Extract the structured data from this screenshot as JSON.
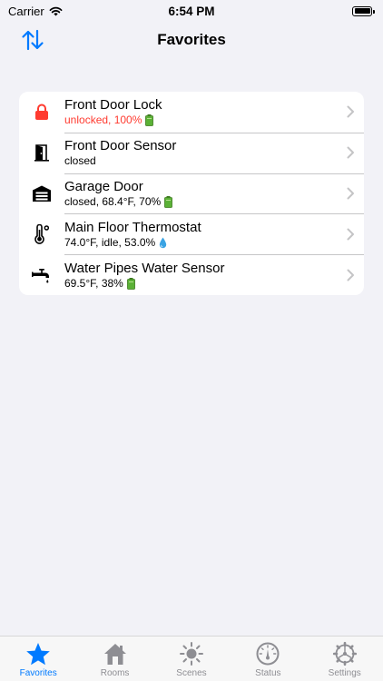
{
  "status_bar": {
    "carrier": "Carrier",
    "time": "6:54 PM"
  },
  "nav": {
    "title": "Favorites",
    "sort_icon": "up-down-arrows-icon"
  },
  "colors": {
    "accent": "#007aff",
    "alert": "#ff3b30",
    "battery_green": "#5bb136",
    "inactive": "#8e8e93"
  },
  "favorites": [
    {
      "title": "Front Door Lock",
      "subtitle": "unlocked, 100%",
      "icon": "lock-icon",
      "alert": true,
      "badge": "battery-icon"
    },
    {
      "title": "Front Door Sensor",
      "subtitle": "closed",
      "icon": "door-icon",
      "alert": false,
      "badge": ""
    },
    {
      "title": "Garage Door",
      "subtitle": "closed, 68.4°F, 70%",
      "icon": "garage-icon",
      "alert": false,
      "badge": "battery-icon"
    },
    {
      "title": "Main Floor Thermostat",
      "subtitle": "74.0°F, idle, 53.0%",
      "icon": "thermometer-icon",
      "alert": false,
      "badge": "water-drop-icon"
    },
    {
      "title": "Water Pipes Water Sensor",
      "subtitle": "69.5°F, 38%",
      "icon": "faucet-icon",
      "alert": false,
      "badge": "battery-icon"
    }
  ],
  "tabs": [
    {
      "label": "Favorites",
      "icon": "star-icon",
      "active": true
    },
    {
      "label": "Rooms",
      "icon": "house-icon",
      "active": false
    },
    {
      "label": "Scenes",
      "icon": "sun-icon",
      "active": false
    },
    {
      "label": "Status",
      "icon": "gauge-icon",
      "active": false
    },
    {
      "label": "Settings",
      "icon": "gear-icon",
      "active": false
    }
  ]
}
